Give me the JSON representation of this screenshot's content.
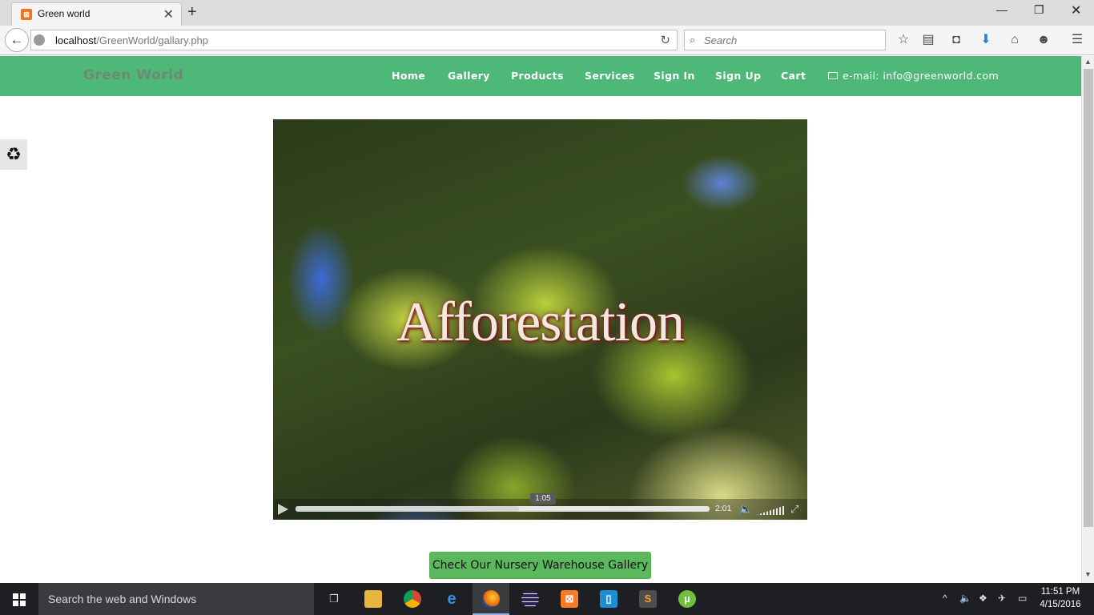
{
  "browser": {
    "tab_title": "Green world",
    "tab_favicon": "xampp-icon",
    "url_host": "localhost",
    "url_path": "/GreenWorld/gallary.php",
    "search_placeholder": "Search"
  },
  "site": {
    "brand": "Green World",
    "nav": [
      "Home",
      "Gallery",
      "Products",
      "Services",
      "Sign In",
      "Sign Up",
      "Cart"
    ],
    "email": "e-mail: info@greenworld.com",
    "video": {
      "title_overlay": "Afforestation",
      "current_time": "1:05",
      "duration": "2:01",
      "progress_percent": 54
    },
    "gallery_button": "Check Our Nursery Warehouse Gallery",
    "side_widget_icon": "recycle-icon"
  },
  "taskbar": {
    "search_placeholder": "Search the web and Windows",
    "time": "11:51 PM",
    "date": "4/15/2016"
  },
  "colors": {
    "site_nav": "#4eb878",
    "brand_text": "#6e8a74",
    "button": "#5cb85c"
  }
}
